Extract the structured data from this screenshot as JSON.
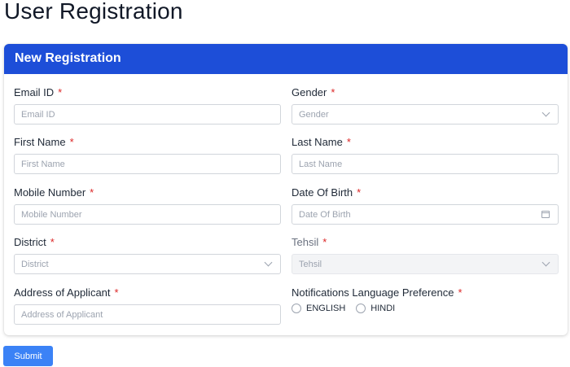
{
  "page": {
    "title": "User Registration"
  },
  "card": {
    "header": "New Registration"
  },
  "form": {
    "required_mark": "*",
    "email": {
      "label": "Email ID",
      "placeholder": "Email ID"
    },
    "gender": {
      "label": "Gender",
      "placeholder": "Gender"
    },
    "first_name": {
      "label": "First Name",
      "placeholder": "First Name"
    },
    "last_name": {
      "label": "Last Name",
      "placeholder": "Last Name"
    },
    "mobile": {
      "label": "Mobile Number",
      "placeholder": "Mobile Number"
    },
    "dob": {
      "label": "Date Of Birth",
      "placeholder": "Date Of Birth"
    },
    "district": {
      "label": "District",
      "placeholder": "District"
    },
    "tehsil": {
      "label": "Tehsil",
      "placeholder": "Tehsil",
      "disabled": true
    },
    "address": {
      "label": "Address of Applicant",
      "placeholder": "Address of Applicant"
    },
    "language": {
      "label": "Notifications Language Preference",
      "options": [
        "ENGLISH",
        "HINDI"
      ]
    }
  },
  "actions": {
    "submit_label": "Submit"
  },
  "colors": {
    "header_bg": "#1d4ed8",
    "submit_bg": "#3b82f6",
    "required": "#dc2626"
  }
}
